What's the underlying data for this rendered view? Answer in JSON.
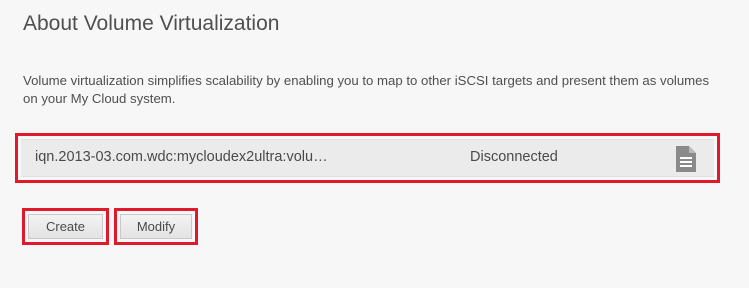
{
  "page": {
    "title": "About Volume Virtualization",
    "description": "Volume virtualization simplifies scalability by enabling you to map to other iSCSI targets and present them as volumes on your My Cloud system."
  },
  "targets": [
    {
      "name": "iqn.2013-03.com.wdc:mycloudex2ultra:volu…",
      "status": "Disconnected",
      "icon": "document-icon"
    }
  ],
  "actions": {
    "create_label": "Create",
    "modify_label": "Modify"
  },
  "colors": {
    "highlight": "#e01a2a",
    "row_background": "#ebebeb",
    "icon": "#8a8a8a"
  }
}
